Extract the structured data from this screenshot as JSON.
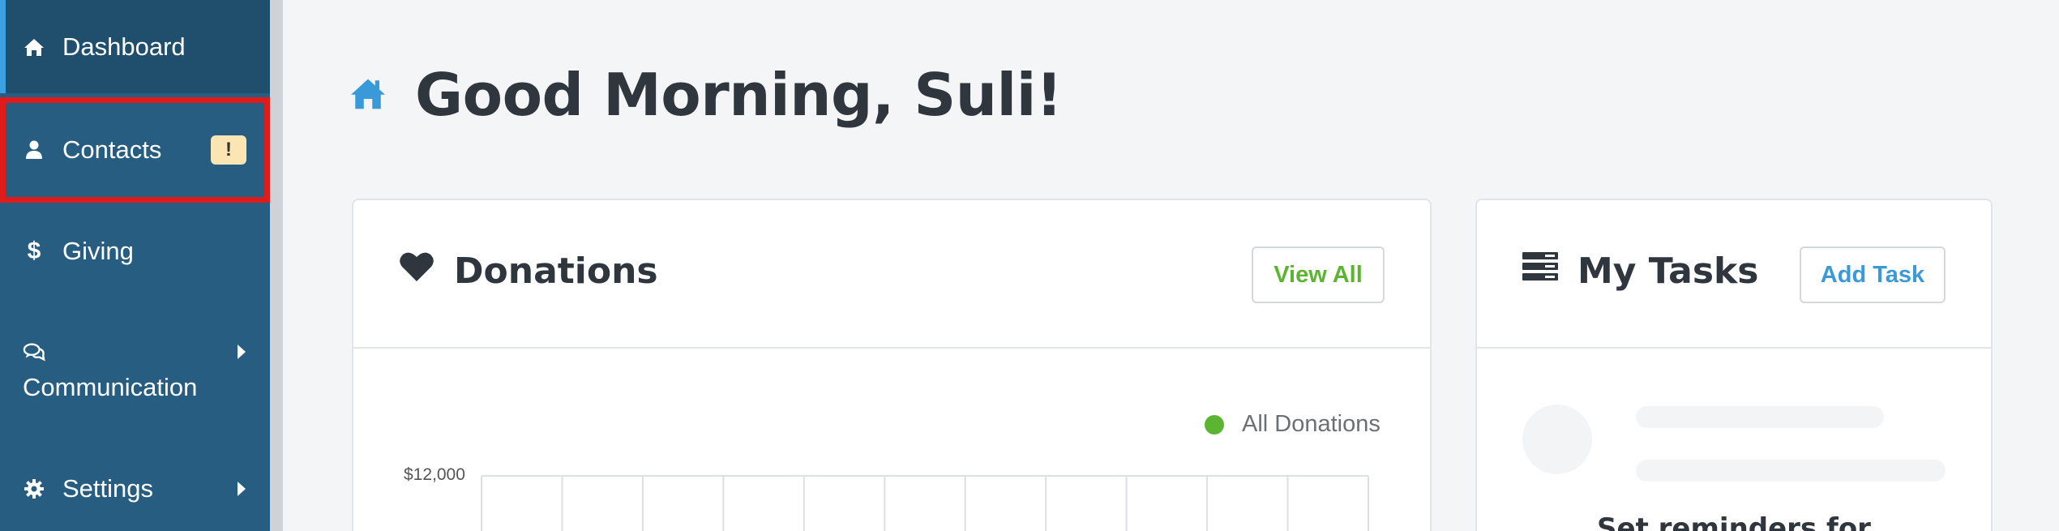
{
  "sidebar": {
    "items": [
      {
        "label": "Dashboard",
        "icon": "home-icon"
      },
      {
        "label": "Contacts",
        "icon": "user-icon",
        "badge": "!"
      },
      {
        "label": "Giving",
        "icon": "dollar-icon"
      },
      {
        "label": "Communication",
        "icon": "chat-icon"
      },
      {
        "label": "Settings",
        "icon": "gear-icon"
      }
    ]
  },
  "header": {
    "title": "Good Morning, Suli!",
    "icon": "home-icon"
  },
  "donations": {
    "title": "Donations",
    "view_all_label": "View All",
    "legend_label": "All Donations"
  },
  "tasks": {
    "title": "My Tasks",
    "add_task_label": "Add Task",
    "empty_text": "Set reminders for"
  },
  "chart_data": {
    "type": "line",
    "series": [
      {
        "name": "All Donations",
        "values": []
      }
    ],
    "y_tick_labels": [
      "$12,000"
    ],
    "grid": true
  },
  "colors": {
    "sidebar_bg": "#265d80",
    "sidebar_active_bg": "#1f4f6d",
    "accent_blue": "#3a9ad9",
    "accent_green": "#5cb531",
    "highlight_red": "#e01b1b"
  }
}
